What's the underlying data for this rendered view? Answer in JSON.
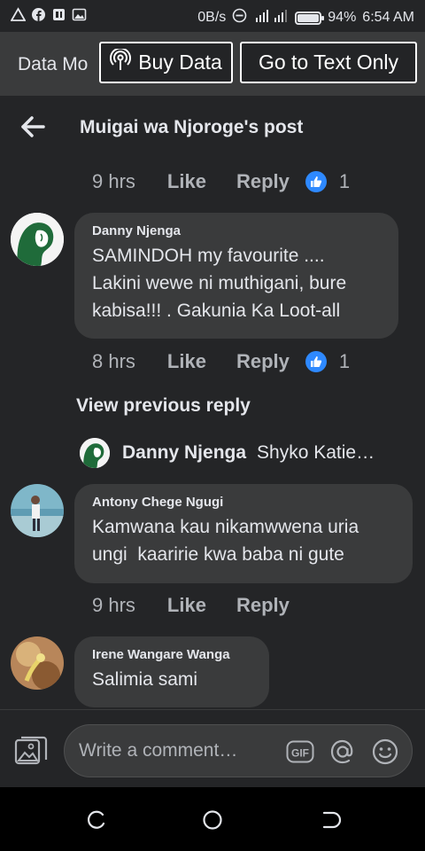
{
  "status_bar": {
    "left_icons": [
      "warning-icon",
      "facebook-icon",
      "sim-icon",
      "image-icon"
    ],
    "data_speed": "0B/s",
    "battery": "94%",
    "time": "6:54 AM"
  },
  "data_bar": {
    "mode_label": "Data Mo",
    "buy_data_label": "Buy Data",
    "text_only_label": "Go to Text Only"
  },
  "header": {
    "title": "Muigai wa Njoroge's post"
  },
  "top_actions": {
    "time": "9 hrs",
    "like": "Like",
    "reply": "Reply",
    "reactions": "1"
  },
  "comments": [
    {
      "author": "Danny Njenga",
      "text": "SAMINDOH my favourite ....\nLakini wewe ni muthigani, bure\nkabisa!!! . Gakunia Ka Loot-all",
      "actions": {
        "time": "8 hrs",
        "like": "Like",
        "reply": "Reply",
        "reactions": "1"
      }
    },
    {
      "author": "Antony Chege Ngugi",
      "text": "Kamwana kau nikamwwena uria\nungi  kaaririe kwa baba ni gute",
      "actions": {
        "time": "9 hrs",
        "like": "Like",
        "reply": "Reply"
      }
    },
    {
      "author": "Irene Wangare Wanga",
      "text": "Salimia sami"
    }
  ],
  "view_previous": "View previous reply",
  "reply_preview": {
    "author": "Danny Njenga",
    "text": "Shyko Katie…"
  },
  "composer": {
    "placeholder": "Write a comment…",
    "gif_label": "GIF"
  },
  "colors": {
    "background": "#242527",
    "bubble": "#3a3b3c",
    "like_blue": "#2e89ff",
    "muted_text": "#b0b3b8"
  }
}
